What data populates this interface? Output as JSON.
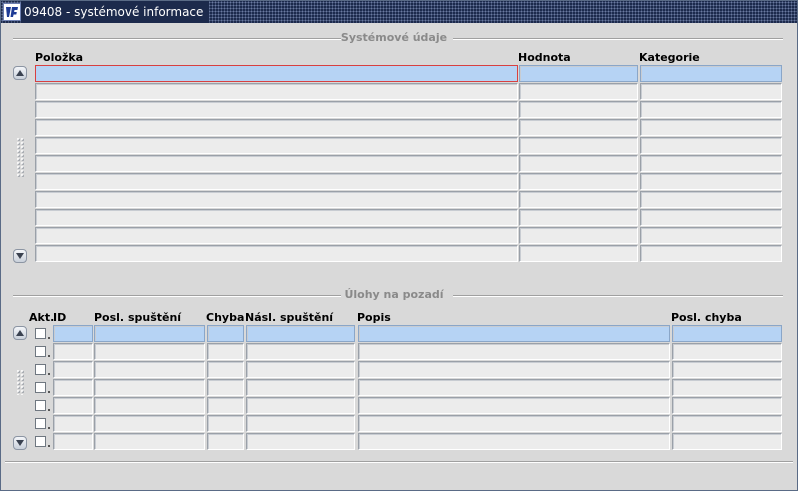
{
  "window": {
    "title": "09408 - systémové informace",
    "logo": "app-logo-icon"
  },
  "system_section": {
    "title": "Systémové údaje",
    "columns": [
      "Položka",
      "Hodnota",
      "Kategorie"
    ],
    "visible_rows": 11,
    "current_row": 1,
    "focused_field": "Položka"
  },
  "background_section": {
    "title": "Úlohy na pozadí",
    "columns": [
      "Akt.",
      "ID",
      "Posl. spuštění",
      "Chyba",
      "Násl. spuštění",
      "Popis",
      "Posl. chyba"
    ],
    "visible_rows": 7,
    "current_row": 1
  },
  "colors": {
    "titlebar": "#1c2a4c",
    "current_row": "#b6d3f4",
    "focus_border": "#d84040",
    "field": "#ececec"
  },
  "icons": [
    "app-logo-icon",
    "scroll-up-icon",
    "scroll-down-icon",
    "checkbox-icon"
  ]
}
